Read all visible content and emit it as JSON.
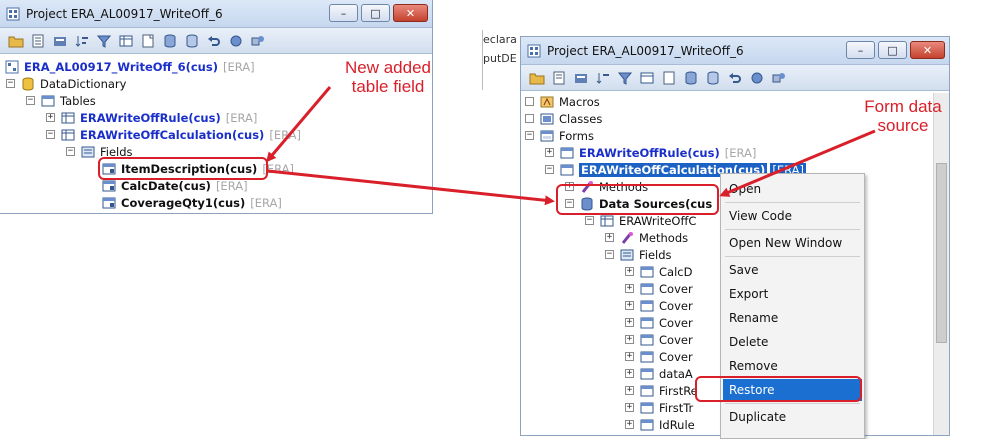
{
  "left_window": {
    "title": "Project ERA_AL00917_WriteOff_6",
    "tree": {
      "root": {
        "label": "ERA_AL00917_WriteOff_6(cus)",
        "tag": "[ERA]"
      },
      "data_dictionary": "DataDictionary",
      "tables": "Tables",
      "table1": {
        "label": "ERAWriteOffRule(cus)",
        "tag": "[ERA]"
      },
      "table2": {
        "label": "ERAWriteOffCalculation(cus)",
        "tag": "[ERA]"
      },
      "fields": "Fields",
      "field1": {
        "label": "ItemDescription(cus)",
        "tag": "[ERA]"
      },
      "field2": {
        "label": "CalcDate(cus)",
        "tag": "[ERA]"
      },
      "field3": {
        "label": "CoverageQty1(cus)",
        "tag": "[ERA]"
      }
    }
  },
  "background_fragments": {
    "line1": "eclara",
    "line2": "putDE"
  },
  "right_window": {
    "title": "Project ERA_AL00917_WriteOff_6",
    "tree": {
      "macros": "Macros",
      "classes": "Classes",
      "forms": "Forms",
      "form1": {
        "label": "ERAWriteOffRule(cus)",
        "tag": "[ERA]"
      },
      "form2": {
        "label": "ERAWriteOffCalculation(cus)",
        "tag": "[ERA]"
      },
      "methods": "Methods",
      "data_sources": "Data Sources(cus",
      "ds1": "ERAWriteOffC",
      "ds_methods": "Methods",
      "ds_fields": "Fields",
      "fields": [
        "CalcD",
        "Cover",
        "Cover",
        "Cover",
        "Cover",
        "Cover",
        "dataA",
        "FirstRe",
        "FirstTr",
        "IdRule"
      ]
    }
  },
  "context_menu": {
    "items": [
      "Open",
      "View Code",
      "Open New Window",
      "Save",
      "Export",
      "Rename",
      "Delete",
      "Remove",
      "Restore",
      "Duplicate"
    ],
    "highlighted": "Restore"
  },
  "annotations": {
    "new_field_line1": "New added",
    "new_field_line2": "table field",
    "form_ds_line1": "Form data",
    "form_ds_line2": "source"
  },
  "colors": {
    "annotation_red": "#d9202a",
    "highlight_blue": "#1b6fd1",
    "selected_blue": "#1c62c5",
    "element_blue": "#1a2fc9"
  },
  "window_buttons": {
    "minimize": "–",
    "maximize": "□",
    "close": "✕"
  }
}
